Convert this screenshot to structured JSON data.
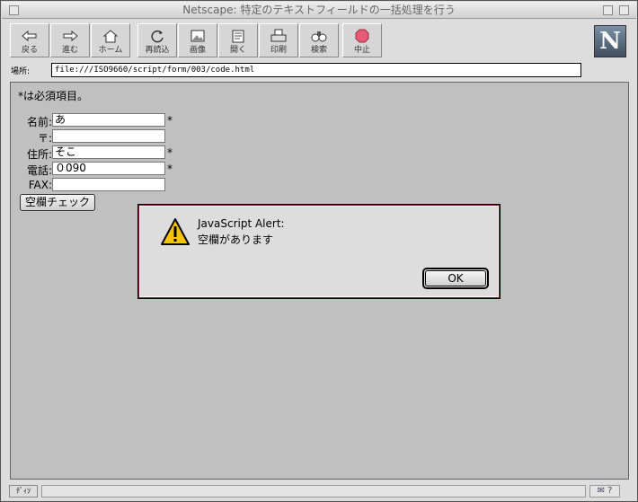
{
  "window": {
    "title": "Netscape: 特定のテキストフィールドの一括処理を行う"
  },
  "toolbar": {
    "back": "戻る",
    "forward": "進む",
    "home": "ホーム",
    "reload": "再読込",
    "images": "画像",
    "open": "開く",
    "print": "印刷",
    "find": "検索",
    "stop": "中止"
  },
  "logo": {
    "letter": "N"
  },
  "location": {
    "label": "場所:",
    "url": "file:///ISO9660/script/form/003/code.html"
  },
  "form": {
    "note": "*は必須項目。",
    "required_mark": "*",
    "fields": [
      {
        "label": "名前:",
        "value": "あ",
        "required": true
      },
      {
        "label": "〒:",
        "value": "",
        "required": false
      },
      {
        "label": "住所:",
        "value": "そこ",
        "required": true
      },
      {
        "label": "電話:",
        "value": "０090",
        "required": true
      },
      {
        "label": "FAX:",
        "value": "",
        "required": false
      }
    ],
    "check_button": "空欄チェック"
  },
  "alert": {
    "title": "JavaScript Alert:",
    "message": "空欄があります",
    "ok": "OK",
    "icon": "warning-icon"
  },
  "statusbar": {
    "security": "ﾃﾞｨｿ",
    "text": ""
  },
  "colors": {
    "content_bg": "#c0c0c0",
    "chrome_bg": "#dddddd",
    "warning": "#f5c400"
  }
}
